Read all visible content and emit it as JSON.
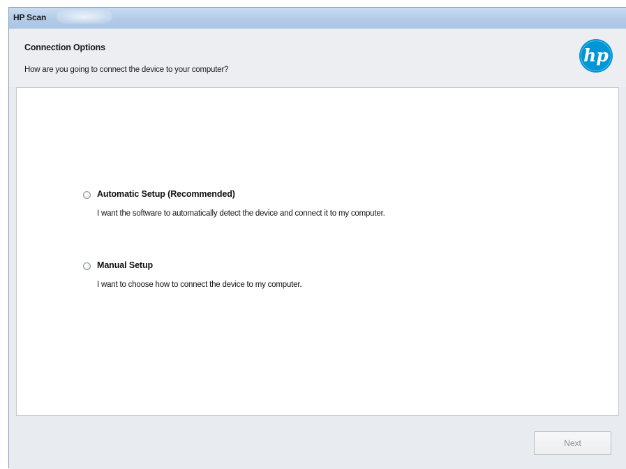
{
  "window": {
    "title": "HP Scan"
  },
  "header": {
    "title": "Connection Options",
    "subtitle": "How are you going to connect the device to your computer?",
    "logo_text": "hp"
  },
  "options": [
    {
      "label": "Automatic Setup (Recommended)",
      "description": "I want the software to automatically detect the device and connect it to my computer.",
      "selected": false
    },
    {
      "label": "Manual Setup",
      "description": "I want to choose how to connect the device to my computer.",
      "selected": false
    }
  ],
  "footer": {
    "next_label": "Next",
    "next_enabled": false
  },
  "colors": {
    "hp_blue": "#0096d6",
    "titlebar": "#b3cbe8",
    "panel": "#e8ebef"
  }
}
